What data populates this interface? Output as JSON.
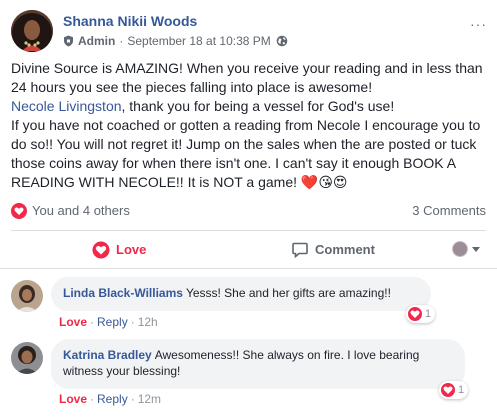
{
  "post": {
    "author": "Shanna Nikii Woods",
    "role": "Admin",
    "separator": "·",
    "timestamp": "September 18 at 10:38 PM",
    "more_label": "···",
    "body": {
      "para1": "Divine Source is AMAZING! When you receive your reading and in less than 24 hours you see the pieces falling into place is awesome!",
      "mention": "Necole Livingston",
      "para2_rest": ", thank you for being a vessel for God's use!",
      "para3": "If you have not coached or gotten a reading from Necole I encourage you to do so!! You will not regret it! Jump on the sales when the are posted or tuck those coins away for when there isn't one. I can't say it enough BOOK A READING WITH NECOLE!! It is NOT a game!",
      "emojis": "❤️😘😍"
    },
    "reactions": {
      "icon": "heart-reaction-icon",
      "summary": "You and 4 others"
    },
    "comments_count": "3 Comments"
  },
  "actions": {
    "love_label": "Love",
    "comment_label": "Comment"
  },
  "comments": [
    {
      "author": "Linda Black-Williams",
      "text": "Yesss! She and her gifts are amazing!!",
      "reaction_count": "1",
      "love_label": "Love",
      "reply_label": "Reply",
      "separator": "·",
      "time": "12h"
    },
    {
      "author": "Katrina Bradley",
      "text": "Awesomeness!! She always on fire. I love bearing witness your blessing!",
      "reaction_count": "1",
      "love_label": "Love",
      "reply_label": "Reply",
      "separator": "·",
      "time": "12m"
    }
  ],
  "colors": {
    "link_blue": "#365899",
    "love_red": "#f0284a",
    "muted_gray": "#606770",
    "bubble_bg": "#f2f3f5"
  }
}
